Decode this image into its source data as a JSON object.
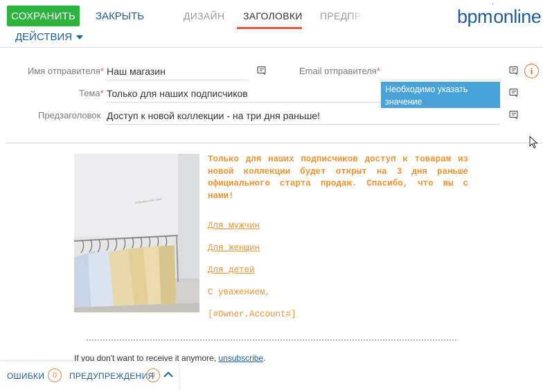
{
  "toolbar": {
    "save_label": "СОХРАНИТЬ",
    "close_label": "ЗАКРЫТЬ",
    "actions_label": "ДЕЙСТВИЯ"
  },
  "tabs": [
    {
      "label": "ДИЗАЙН",
      "active": false
    },
    {
      "label": "ЗАГОЛОВКИ",
      "active": true
    },
    {
      "label": "ПРЕДПРОСМОТР",
      "active": false
    }
  ],
  "logo": {
    "text": "bpm",
    "mark": "'",
    "text2": "online"
  },
  "form": {
    "sender_name_label": "Имя отправителя",
    "sender_name_value": "Наш магазин",
    "sender_email_label": "Email отправителя",
    "sender_email_value": "",
    "subject_label": "Тема",
    "subject_value": "Только для наших подписчиков",
    "preheader_label": "Предзаголовок",
    "preheader_value": "Доступ к новой коллекции - на три дня раньше!",
    "required_mark": "*",
    "validation_tooltip": "Необходимо указать значение",
    "info_symbol": "i"
  },
  "email": {
    "paragraph": "Только для наших подписчиков доступ к товарам из новой коллекции будет открыт на 3 дня раньше официального старта продаж. Спасибо, что вы с нами!",
    "link_men": "Для мужчин",
    "link_women": "Для женщин",
    "link_kids": "Для детей",
    "regards": "С уважением,",
    "owner_macro": "[#Owner.Account#]",
    "unsubscribe_prefix": "If you don't want to receive it anymore, ",
    "unsubscribe_link": "unsubscribe",
    "unsubscribe_suffix": "."
  },
  "status_bar": {
    "errors_label": "ОШИБКИ",
    "errors_count": "0",
    "warnings_label": "ПРЕДУПРЕЖДЕНИЯ",
    "warnings_count": "0"
  },
  "colors": {
    "save_green": "#2fb33f",
    "link_blue": "#1e5d99",
    "tab_underline": "#e9553b",
    "email_orange": "#f0922e",
    "tooltip_blue": "#4aa3d8",
    "required_red": "#e05a3a"
  }
}
